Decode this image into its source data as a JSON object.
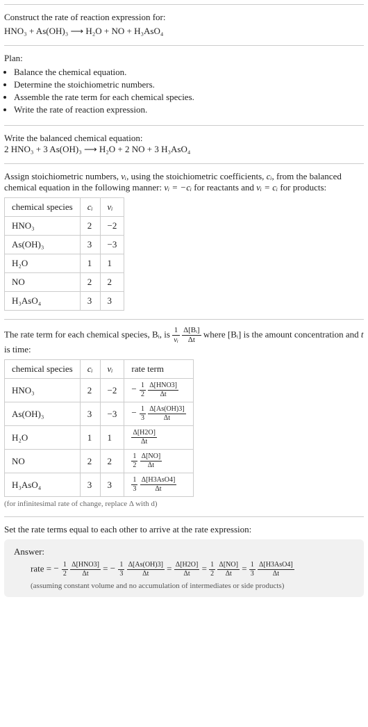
{
  "intro": {
    "line1": "Construct the rate of reaction expression for:",
    "eqn": "HNO₃ + As(OH)₃  ⟶  H₂O + NO + H₃AsO₄"
  },
  "plan": {
    "heading": "Plan:",
    "items": [
      "Balance the chemical equation.",
      "Determine the stoichiometric numbers.",
      "Assemble the rate term for each chemical species.",
      "Write the rate of reaction expression."
    ]
  },
  "balanced": {
    "heading": "Write the balanced chemical equation:",
    "eqn": "2 HNO₃ + 3 As(OH)₃  ⟶  H₂O + 2 NO + 3 H₃AsO₄"
  },
  "assign": {
    "text_a": "Assign stoichiometric numbers, ",
    "nu_i": "νᵢ",
    "text_b": ", using the stoichiometric coefficients, ",
    "c_i": "cᵢ",
    "text_c": ", from the balanced chemical equation in the following manner: ",
    "rel1": "νᵢ = −cᵢ",
    "text_d": " for reactants and ",
    "rel2": "νᵢ = cᵢ",
    "text_e": " for products:",
    "headers": [
      "chemical species",
      "cᵢ",
      "νᵢ"
    ],
    "rows": [
      [
        "HNO₃",
        "2",
        "−2"
      ],
      [
        "As(OH)₃",
        "3",
        "−3"
      ],
      [
        "H₂O",
        "1",
        "1"
      ],
      [
        "NO",
        "2",
        "2"
      ],
      [
        "H₃AsO₄",
        "3",
        "3"
      ]
    ]
  },
  "rate_intro": {
    "text_a": "The rate term for each chemical species, ",
    "Bi": "Bᵢ",
    "text_b": ", is ",
    "lead_num": "1",
    "lead_den": "νᵢ",
    "main_num": "Δ[Bᵢ]",
    "main_den": "Δt",
    "text_c": " where ",
    "conc": "[Bᵢ]",
    "text_d": " is the amount concentration and ",
    "t": "t",
    "text_e": " is time:"
  },
  "rate_table": {
    "headers": [
      "chemical species",
      "cᵢ",
      "νᵢ",
      "rate term"
    ],
    "rows": [
      {
        "sp": "HNO₃",
        "c": "2",
        "nu": "−2",
        "sign": "−",
        "fnum": "1",
        "fden": "2",
        "dnum": "Δ[HNO3]",
        "dden": "Δt"
      },
      {
        "sp": "As(OH)₃",
        "c": "3",
        "nu": "−3",
        "sign": "−",
        "fnum": "1",
        "fden": "3",
        "dnum": "Δ[As(OH)3]",
        "dden": "Δt"
      },
      {
        "sp": "H₂O",
        "c": "1",
        "nu": "1",
        "sign": "",
        "fnum": "",
        "fden": "",
        "dnum": "Δ[H2O]",
        "dden": "Δt"
      },
      {
        "sp": "NO",
        "c": "2",
        "nu": "2",
        "sign": "",
        "fnum": "1",
        "fden": "2",
        "dnum": "Δ[NO]",
        "dden": "Δt"
      },
      {
        "sp": "H₃AsO₄",
        "c": "3",
        "nu": "3",
        "sign": "",
        "fnum": "1",
        "fden": "3",
        "dnum": "Δ[H3AsO4]",
        "dden": "Δt"
      }
    ],
    "note": "(for infinitesimal rate of change, replace Δ with d)"
  },
  "final": {
    "heading": "Set the rate terms equal to each other to arrive at the rate expression:",
    "answer_label": "Answer:",
    "rate_prefix": "rate = ",
    "eq": " = ",
    "terms": [
      {
        "sign": "−",
        "fnum": "1",
        "fden": "2",
        "dnum": "Δ[HNO3]",
        "dden": "Δt"
      },
      {
        "sign": "−",
        "fnum": "1",
        "fden": "3",
        "dnum": "Δ[As(OH)3]",
        "dden": "Δt"
      },
      {
        "sign": "",
        "fnum": "",
        "fden": "",
        "dnum": "Δ[H2O]",
        "dden": "Δt"
      },
      {
        "sign": "",
        "fnum": "1",
        "fden": "2",
        "dnum": "Δ[NO]",
        "dden": "Δt"
      },
      {
        "sign": "",
        "fnum": "1",
        "fden": "3",
        "dnum": "Δ[H3AsO4]",
        "dden": "Δt"
      }
    ],
    "assumption": "(assuming constant volume and no accumulation of intermediates or side products)"
  }
}
